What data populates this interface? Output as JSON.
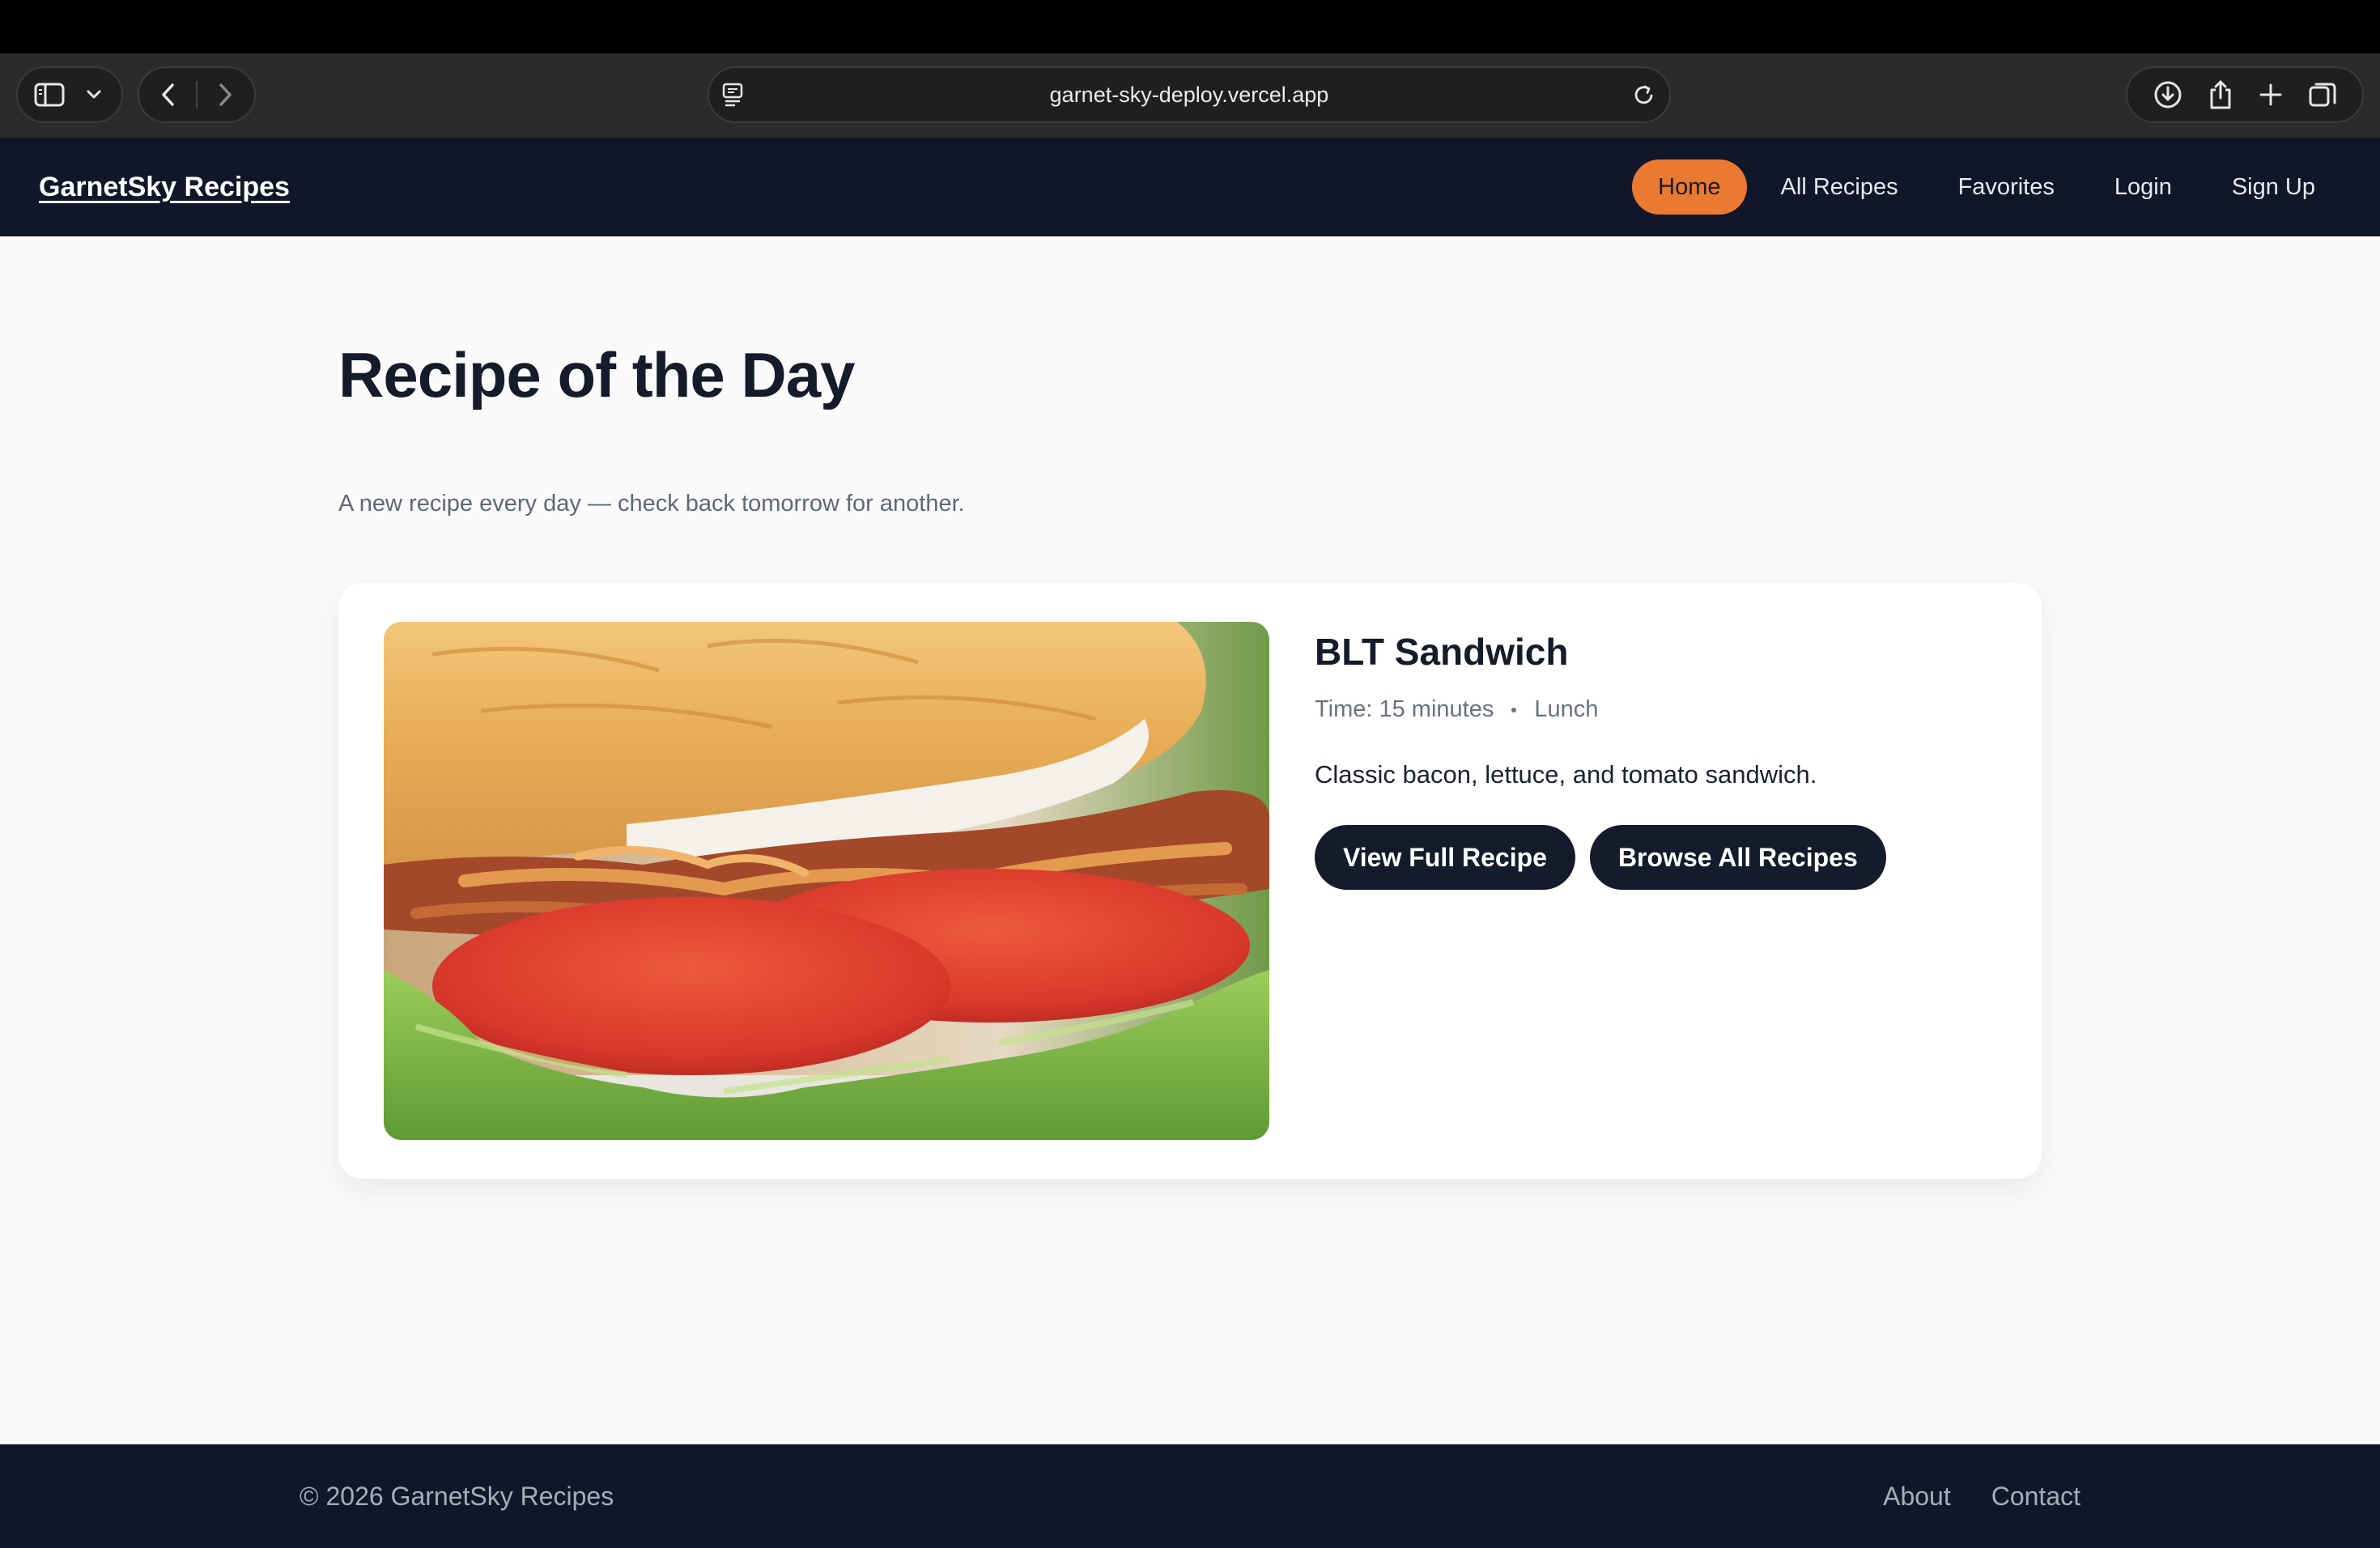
{
  "browser": {
    "url": "garnet-sky-deploy.vercel.app",
    "icons": [
      "sidebar-icon",
      "chevron-down-icon",
      "back-icon",
      "forward-icon",
      "page-settings-icon",
      "reload-icon",
      "download-icon",
      "share-icon",
      "new-tab-icon",
      "tab-overview-icon"
    ]
  },
  "header": {
    "brand": "GarnetSky Recipes",
    "nav": [
      {
        "label": "Home",
        "active": true
      },
      {
        "label": "All Recipes",
        "active": false
      },
      {
        "label": "Favorites",
        "active": false
      },
      {
        "label": "Login",
        "active": false
      },
      {
        "label": "Sign Up",
        "active": false
      }
    ]
  },
  "main": {
    "title": "Recipe of the Day",
    "subtitle": "A new recipe every day — check back tomorrow for another.",
    "recipe": {
      "name": "BLT Sandwich",
      "time": "Time: 15 minutes",
      "category": "Lunch",
      "description": "Classic bacon, lettuce, and tomato sandwich.",
      "primary_button": "View Full Recipe",
      "secondary_button": "Browse All Recipes"
    }
  },
  "footer": {
    "copyright": "© 2026 GarnetSky Recipes",
    "links": [
      "About",
      "Contact"
    ]
  },
  "colors": {
    "header_bg": "#111729",
    "accent": "#ea7a32",
    "button_bg": "#141b2b",
    "page_bg": "#fafafa"
  }
}
